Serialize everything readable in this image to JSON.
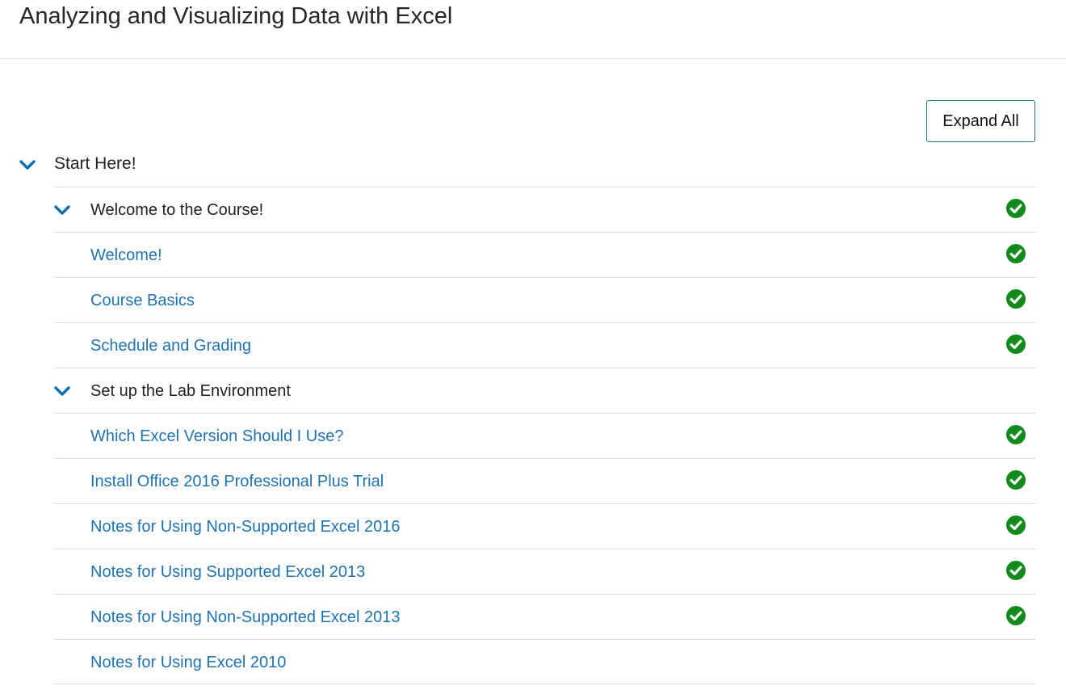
{
  "page": {
    "title": "Analyzing and Visualizing Data with Excel"
  },
  "toolbar": {
    "expand_all_label": "Expand All"
  },
  "colors": {
    "chevron": "#0a6fb0",
    "link": "#1f72b0",
    "check": "#138a1c"
  },
  "section": {
    "label": "Start Here!",
    "icon": "chevron-down-icon",
    "rows": [
      {
        "kind": "group",
        "label": "Welcome to the Course!",
        "completed": true
      },
      {
        "kind": "item",
        "label": "Welcome!",
        "completed": true
      },
      {
        "kind": "item",
        "label": "Course Basics",
        "completed": true
      },
      {
        "kind": "item",
        "label": "Schedule and Grading",
        "completed": true
      },
      {
        "kind": "group",
        "label": "Set up the Lab Environment",
        "completed": false
      },
      {
        "kind": "item",
        "label": "Which Excel Version Should I Use?",
        "completed": true
      },
      {
        "kind": "item",
        "label": "Install Office 2016 Professional Plus Trial",
        "completed": true
      },
      {
        "kind": "item",
        "label": "Notes for Using Non-Supported Excel 2016",
        "completed": true
      },
      {
        "kind": "item",
        "label": "Notes for Using Supported Excel 2013",
        "completed": true
      },
      {
        "kind": "item",
        "label": "Notes for Using Non-Supported Excel 2013",
        "completed": true
      },
      {
        "kind": "item",
        "label": "Notes for Using Excel 2010",
        "completed": false
      }
    ]
  }
}
